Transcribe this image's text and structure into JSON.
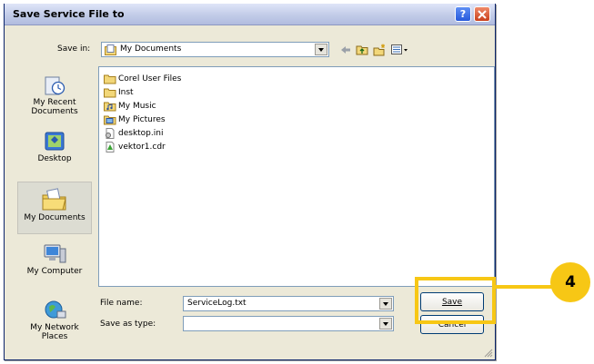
{
  "dialog": {
    "title": "Save Service File to",
    "help_button": "?",
    "close_icon": "close-x-icon"
  },
  "save_in": {
    "label": "Save in:",
    "value": "My Documents",
    "toolbar_icons": [
      "back-arrow-icon",
      "up-folder-icon",
      "new-folder-icon",
      "view-menu-icon"
    ]
  },
  "places": [
    {
      "label": "My Recent Documents",
      "icon": "recent-documents-icon"
    },
    {
      "label": "Desktop",
      "icon": "desktop-icon"
    },
    {
      "label": "My Documents",
      "icon": "my-documents-icon",
      "selected": true
    },
    {
      "label": "My Computer",
      "icon": "computer-icon"
    },
    {
      "label": "My Network Places",
      "icon": "network-places-icon"
    }
  ],
  "files": [
    {
      "name": "Corel User Files",
      "icon": "folder-icon"
    },
    {
      "name": "Inst",
      "icon": "folder-icon"
    },
    {
      "name": "My Music",
      "icon": "music-folder-icon"
    },
    {
      "name": "My Pictures",
      "icon": "pictures-folder-icon"
    },
    {
      "name": "desktop.ini",
      "icon": "ini-file-icon"
    },
    {
      "name": "vektor1.cdr",
      "icon": "cdr-file-icon"
    }
  ],
  "file_name": {
    "label": "File name:",
    "value": "ServiceLog.txt"
  },
  "save_as_type": {
    "label": "Save as type:",
    "value": ""
  },
  "buttons": {
    "save": "Save",
    "cancel": "Cancel"
  },
  "callout": {
    "step": "4",
    "highlight_color": "#f7c715"
  },
  "colors": {
    "dialog_bg": "#ece9d8",
    "title_gradient_top": "#dfe5f8",
    "field_border": "#7f9db9"
  }
}
